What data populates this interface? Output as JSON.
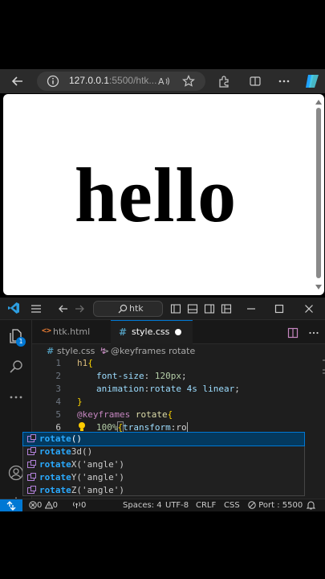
{
  "browser": {
    "url_host": "127.0.0.1",
    "url_rest": ":5500/htk..."
  },
  "page": {
    "heading": "hello"
  },
  "vscode": {
    "search": "htk",
    "tabs": [
      {
        "label": "htk.html",
        "icon": "html-file-icon"
      },
      {
        "label": "style.css",
        "icon": "css-file-icon"
      }
    ],
    "breadcrumb": {
      "file": "style.css",
      "separator": ">",
      "symbol": "@keyframes rotate"
    },
    "lines": [
      {
        "n": "1"
      },
      {
        "n": "2"
      },
      {
        "n": "3"
      },
      {
        "n": "4"
      },
      {
        "n": "5"
      },
      {
        "n": "6"
      }
    ],
    "code": {
      "l1_sel": "h1",
      "l1_brace": "{",
      "l2_prop": "font-size",
      "l2_colon": ": ",
      "l2_val": "120px",
      "l2_end": ";",
      "l3_prop": "animation",
      "l3_colon": ":",
      "l3_val": "rotate 4s linear",
      "l3_end": ";",
      "l4_brace": "}",
      "l5_at": "@keyframes",
      "l5_name": " rotate",
      "l5_brace": "{",
      "l6_pct": "100%",
      "l6_brace": "{",
      "l6_prop": "transform",
      "l6_colon": ":",
      "l6_typed": "ro"
    },
    "suggestions": [
      {
        "match": "rotate",
        "rest": "()"
      },
      {
        "match": "rotate",
        "rest": "3d()"
      },
      {
        "match": "rotate",
        "rest": "X('angle')"
      },
      {
        "match": "rotate",
        "rest": "Y('angle')"
      },
      {
        "match": "rotate",
        "rest": "Z('angle')"
      }
    ],
    "explorer_badge": "1",
    "status": {
      "errors": "0",
      "warnings": "0",
      "ports": "0",
      "spaces": "Spaces: 4",
      "encoding": "UTF-8",
      "eol": "CRLF",
      "language": "CSS",
      "live_server": "Port : 5500"
    }
  },
  "colors": {
    "accent": "#0078d4",
    "editor_bg": "#1e1e1e",
    "browser_bar": "#2b2b2b"
  }
}
